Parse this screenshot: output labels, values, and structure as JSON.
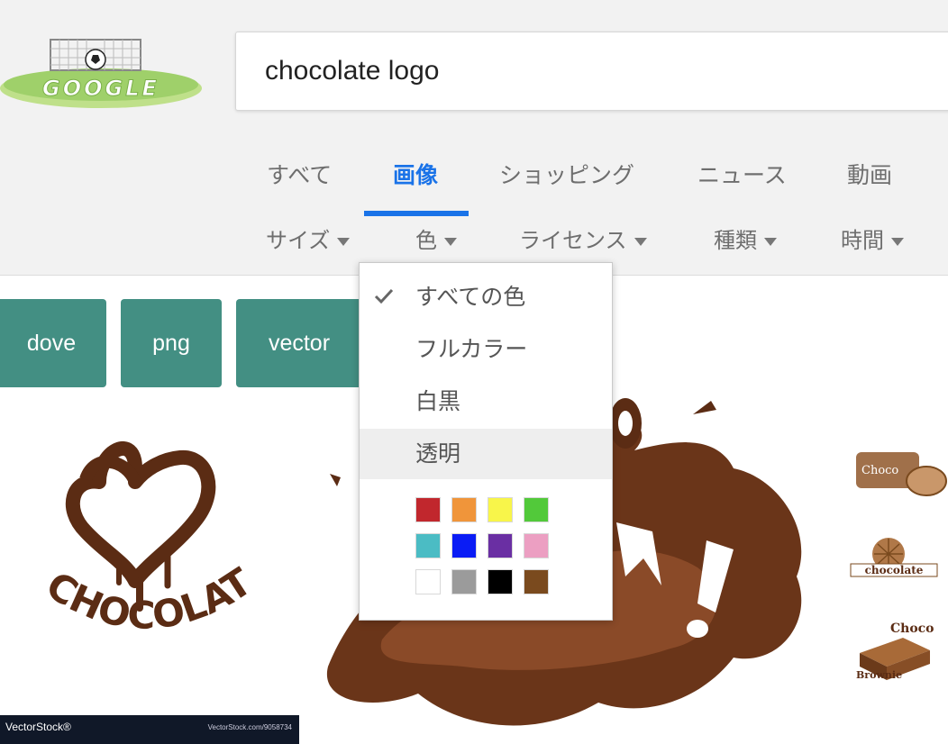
{
  "search": {
    "query": "chocolate logo"
  },
  "logo": {
    "text": "GOOGLE"
  },
  "tabs": [
    {
      "label": "すべて",
      "active": false
    },
    {
      "label": "画像",
      "active": true
    },
    {
      "label": "ショッピング",
      "active": false
    },
    {
      "label": "ニュース",
      "active": false
    },
    {
      "label": "動画",
      "active": false
    }
  ],
  "tools": [
    {
      "label": "サイズ"
    },
    {
      "label": "色"
    },
    {
      "label": "ライセンス"
    },
    {
      "label": "種類"
    },
    {
      "label": "時間"
    }
  ],
  "chips": [
    {
      "label": "dove"
    },
    {
      "label": "png"
    },
    {
      "label": "vector"
    }
  ],
  "color_menu": {
    "items": [
      {
        "label": "すべての色",
        "checked": true
      },
      {
        "label": "フルカラー",
        "checked": false
      },
      {
        "label": "白黒",
        "checked": false
      },
      {
        "label": "透明",
        "checked": false,
        "hovered": true
      }
    ],
    "swatches": [
      [
        "#c1272d",
        "#f0953a",
        "#f8f54a",
        "#52c93a"
      ],
      [
        "#4bbcc4",
        "#0a1cf5",
        "#6a2fa3",
        "#ec9fc2"
      ],
      [
        "#ffffff",
        "#9b9b9b",
        "#000000",
        "#7a4a1e"
      ]
    ]
  },
  "results": {
    "r1": {
      "word": "CHOCOLATE",
      "watermark_left": "VectorStock®",
      "watermark_right": "VectorStock.com/9058734"
    },
    "r3": {
      "labels": [
        "Choco",
        "chocolate",
        "Choco",
        "Brownie"
      ]
    }
  }
}
